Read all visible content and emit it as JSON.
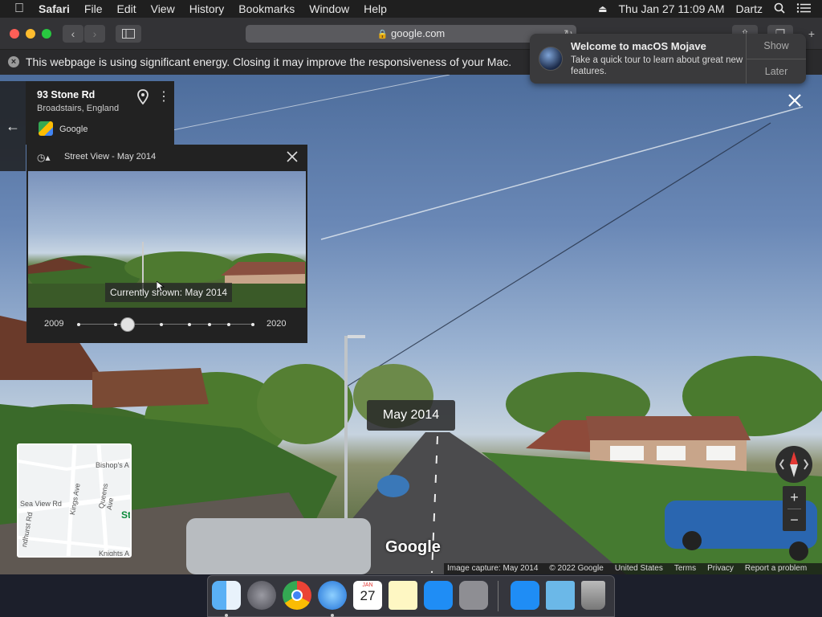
{
  "menubar": {
    "apple": "",
    "app": "Safari",
    "items": [
      "File",
      "Edit",
      "View",
      "History",
      "Bookmarks",
      "Window",
      "Help"
    ],
    "datetime": "Thu Jan 27  11:09 AM",
    "user": "Dartz"
  },
  "browser": {
    "url": "google.com"
  },
  "energy_notice": {
    "text": "This webpage is using significant energy. Closing it may improve the responsiveness of your Mac."
  },
  "notification": {
    "title": "Welcome to macOS Mojave",
    "body": "Take a quick tour to learn about great new features.",
    "show_label": "Show",
    "later_label": "Later"
  },
  "place": {
    "title": "93 Stone Rd",
    "subtitle": "Broadstairs, England",
    "source": "Google"
  },
  "timeline": {
    "title": "Street View - May 2014",
    "currently_shown": "Currently shown: May 2014",
    "start_year": "2009",
    "end_year": "2020",
    "position": 0.28
  },
  "date_badge": "May 2014",
  "minimap": {
    "labels": [
      "Bishop's A",
      "Sea View Rd",
      "Kings Ave",
      "Queens Ave",
      "St",
      "ndhurst Rd",
      "Knights A"
    ]
  },
  "zoom": {
    "plus": "+",
    "minus": "−"
  },
  "branding": "Google",
  "footer": {
    "capture": "Image capture: May 2014",
    "copyright": "© 2022 Google",
    "country": "United States",
    "terms": "Terms",
    "privacy": "Privacy",
    "report": "Report a problem"
  },
  "dock": {
    "calendar_month": "JAN",
    "calendar_day": "27"
  }
}
